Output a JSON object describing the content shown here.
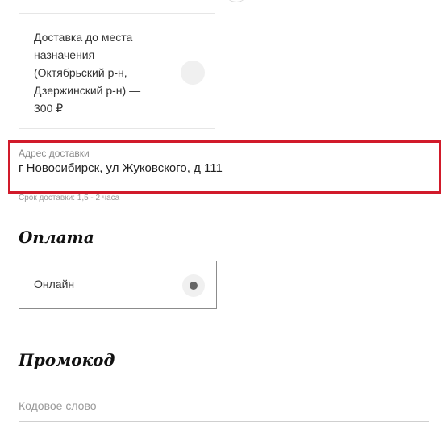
{
  "delivery_option": {
    "lines": [
      "Доставка до места",
      "назначения",
      "(Октябрьский р-н,",
      "Дзержинский р-н) —",
      "300 ₽"
    ]
  },
  "address": {
    "label": "Адрес доставки",
    "value": "г Новосибирск, ул Жуковского, д 111",
    "delivery_time": "Срок доставки: 1,5 - 2 часа"
  },
  "payment": {
    "title": "Оплата",
    "option_label": "Онлайн"
  },
  "promo": {
    "title": "Промокод",
    "placeholder": "Кодовое слово"
  },
  "colors": {
    "highlight": "#d11a2a"
  }
}
